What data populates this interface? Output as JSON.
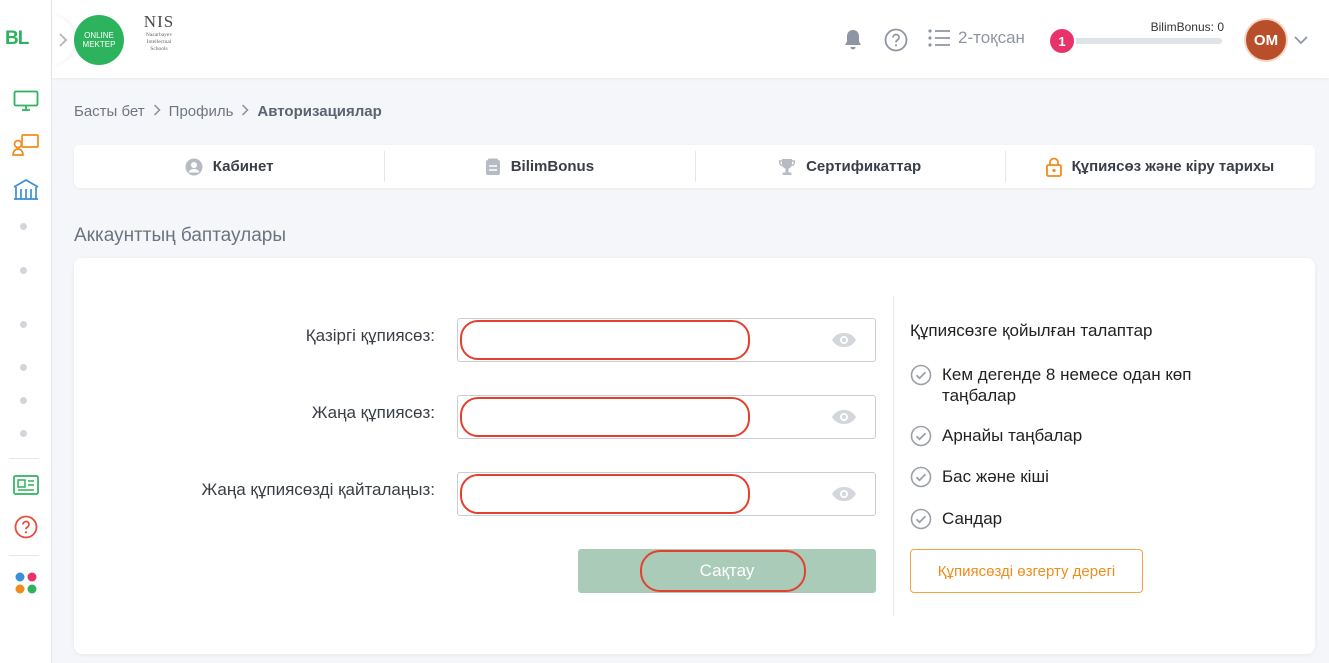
{
  "brand": {
    "bl_logo": "BL",
    "online_mektep_line1": "ONLINE",
    "online_mektep_line2": "MEKTEP",
    "nis_title": "NIS",
    "nis_sub1": "Nazarbayev",
    "nis_sub2": "Intellectual",
    "nis_sub3": "Schools"
  },
  "header": {
    "quarter_label": "2-тоқсан",
    "bonus_label": "BilimBonus: 0",
    "level": "1",
    "bonus_progress": 0.05,
    "avatar_initials": "OM"
  },
  "breadcrumb": {
    "home": "Басты бет",
    "profile": "Профиль",
    "current": "Авторизациялар"
  },
  "tabs": [
    {
      "label": "Кабинет",
      "icon": "user-icon"
    },
    {
      "label": "BilimBonus",
      "icon": "bonus-icon"
    },
    {
      "label": "Сертификаттар",
      "icon": "trophy-icon"
    },
    {
      "label": "Құпиясөз және кіру тарихы",
      "icon": "lock-icon"
    }
  ],
  "section_title": "Аккаунттың баптаулары",
  "form": {
    "current_password_label": "Қазіргі құпиясөз:",
    "new_password_label": "Жаңа құпиясөз:",
    "repeat_password_label": "Жаңа құпиясөзді қайталаңыз:",
    "current_password_value": "",
    "new_password_value": "",
    "repeat_password_value": "",
    "save_label": "Сақтау"
  },
  "requirements": {
    "title": "Құпиясөзге қойылған талаптар",
    "items": [
      "Кем дегенде 8 немесе одан көп таңбалар",
      "Арнайы таңбалар",
      "Бас және кіші",
      "Сандар"
    ],
    "history_button": "Құпиясөзді өзгерту дерегі"
  },
  "colors": {
    "brand_green": "#2db35d",
    "accent_orange": "#f08c1c",
    "save_button": "#a9cbb8",
    "highlight_ring": "#e3412d",
    "level_badge": "#e8326a"
  }
}
